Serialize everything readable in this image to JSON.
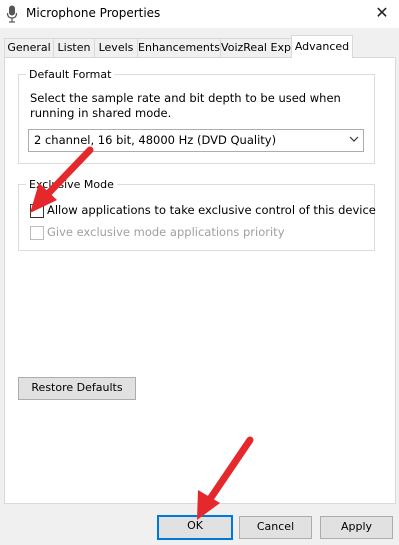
{
  "window": {
    "title": "Microphone Properties",
    "close_glyph": "✕"
  },
  "tabs": [
    {
      "label": "General"
    },
    {
      "label": "Listen"
    },
    {
      "label": "Levels"
    },
    {
      "label": "Enhancements"
    },
    {
      "label": "VoizReal Exp"
    },
    {
      "label": "Advanced"
    }
  ],
  "active_tab": "Advanced",
  "default_format": {
    "legend": "Default Format",
    "instructions": "Select the sample rate and bit depth to be used when running in shared mode.",
    "selected_value": "2 channel, 16 bit, 48000 Hz (DVD Quality)"
  },
  "exclusive_mode": {
    "legend": "Exclusive Mode",
    "allow_label": "Allow applications to take exclusive control of this device",
    "allow_checked": false,
    "priority_label": "Give exclusive mode applications priority",
    "priority_checked": false,
    "priority_enabled": false
  },
  "buttons": {
    "restore": "Restore Defaults",
    "ok": "OK",
    "cancel": "Cancel",
    "apply": "Apply"
  },
  "colors": {
    "annotation_arrow": "#e5282c",
    "default_button_border": "#0078d7"
  }
}
